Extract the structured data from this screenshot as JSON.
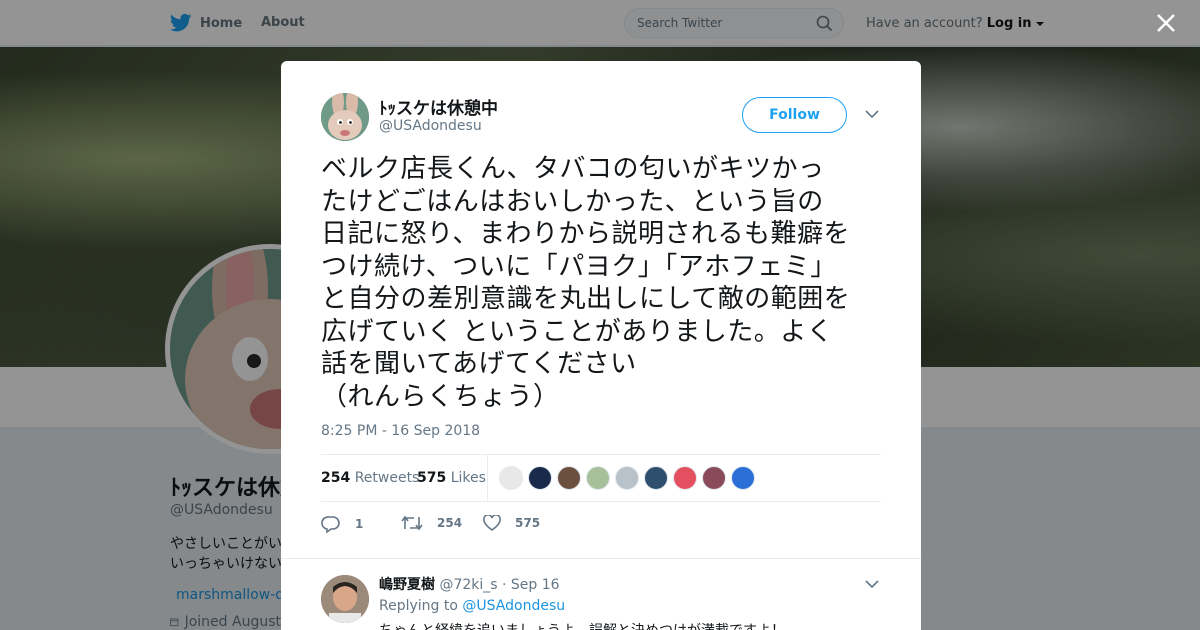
{
  "nav": {
    "home_label": "Home",
    "about_label": "About",
    "search_placeholder": "Search Twitter",
    "account_prompt": "Have an account?",
    "login_label": "Log in"
  },
  "colors": {
    "brand": "#1da1f2",
    "link": "#1b95e0",
    "muted": "#657786"
  },
  "profile": {
    "name": "ﾄｯスケは休憩中",
    "handle": "@USAdondesu",
    "bio_lines": [
      "やさしいことがい",
      "いっちゃいけない"
    ],
    "link_text": "marshmallow-qa",
    "joined_text": "Joined August"
  },
  "tweet": {
    "author_name": "ﾄｯスケは休憩中",
    "author_handle": "@USAdondesu",
    "follow_label": "Follow",
    "text_lines": [
      "ベルク店長くん、タバコの匂いがキツかっ",
      "たけどごはんはおいしかった、という旨の",
      "日記に怒り、まわりから説明されるも難癖を",
      "つけ続け、ついに「パヨク」「アホフェミ」",
      "と自分の差別意識を丸出しにして敵の範囲を",
      "広げていく ということがありました。よく",
      "話を聞いてあげてください",
      "（れんらくちょう）"
    ],
    "timestamp": "8:25 PM - 16 Sep 2018",
    "retweets_count": "254",
    "retweets_label": "Retweets",
    "likes_count": "575",
    "likes_label": "Likes",
    "liker_colors": [
      "#e8e8e8",
      "#1a2a4a",
      "#6b5040",
      "#a7c09a",
      "#b8c2c8",
      "#2e4f6e",
      "#e55060",
      "#8a4a5a",
      "#2a6fd6"
    ],
    "reply_count": "1",
    "retweet_action_count": "254",
    "like_action_count": "575"
  },
  "reply": {
    "author_name": "嶋野夏樹",
    "author_handle": "@72ki_s",
    "date": "Sep 16",
    "replying_prefix": "Replying to",
    "replying_to": "@USAdondesu",
    "text": "ちゃんと経緯を追いましょうよ。誤解と決めつけが満載ですよ！"
  }
}
